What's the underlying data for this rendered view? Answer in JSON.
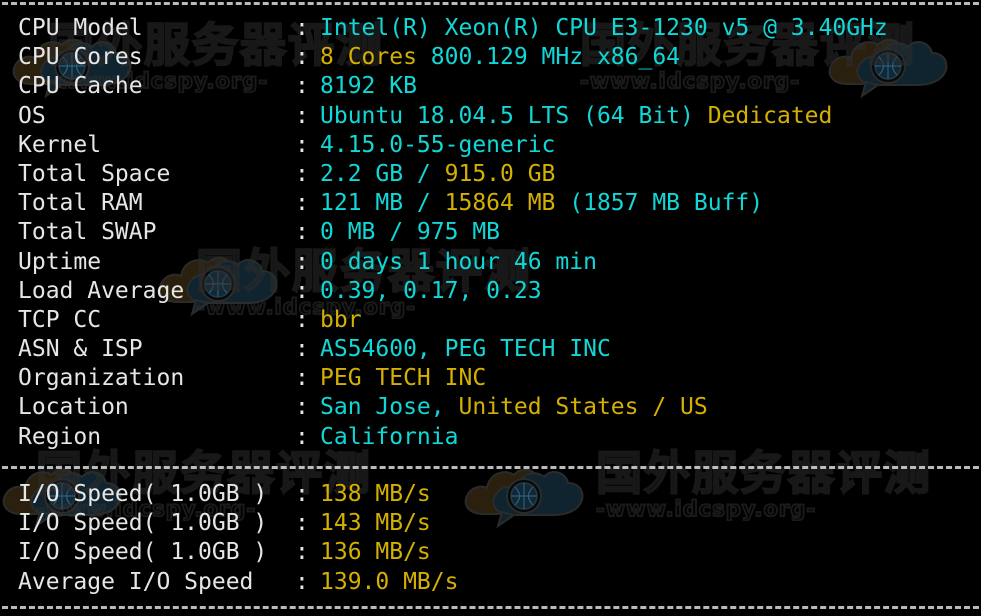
{
  "terminal": {
    "background_color": "#000000",
    "label_color": "#e6e6e6",
    "cyan_color": "#11d7d7",
    "yellow_color": "#d4b000",
    "separator_char": "-"
  },
  "watermark": {
    "cn_text": "国外服务器评测",
    "url_text": "-www.idcspy.org-",
    "logo_name": "cloud-globe-logo"
  },
  "system_info": {
    "section_name": "system-information",
    "rows": [
      {
        "label": "CPU Model",
        "separator": ":",
        "value": "Intel(R) Xeon(R) CPU E3-1230 v5 @ 3.40GHz",
        "segments": [
          {
            "text": "Intel(R) Xeon(R) CPU E3-1230 v5 @ 3.40GHz",
            "color": "cyan"
          }
        ]
      },
      {
        "label": "CPU Cores",
        "separator": ":",
        "value": "8 Cores 800.129 MHz x86_64",
        "segments": [
          {
            "text": "8 Cores",
            "color": "yellow"
          },
          {
            "text": " 800.129 MHz x86_64",
            "color": "cyan"
          }
        ]
      },
      {
        "label": "CPU Cache",
        "separator": ":",
        "value": "8192 KB",
        "segments": [
          {
            "text": "8192 KB",
            "color": "cyan"
          }
        ]
      },
      {
        "label": "OS",
        "separator": ":",
        "value": "Ubuntu 18.04.5 LTS (64 Bit) Dedicated",
        "segments": [
          {
            "text": "Ubuntu 18.04.5 LTS (64 Bit) ",
            "color": "cyan"
          },
          {
            "text": "Dedicated",
            "color": "yellow"
          }
        ]
      },
      {
        "label": "Kernel",
        "separator": ":",
        "value": "4.15.0-55-generic",
        "segments": [
          {
            "text": "4.15.0-55-generic",
            "color": "cyan"
          }
        ]
      },
      {
        "label": "Total Space",
        "separator": ":",
        "value": "2.2 GB / 915.0 GB",
        "segments": [
          {
            "text": "2.2 GB / ",
            "color": "cyan"
          },
          {
            "text": "915.0 GB",
            "color": "yellow"
          }
        ]
      },
      {
        "label": "Total RAM",
        "separator": ":",
        "value": "121 MB / 15864 MB (1857 MB Buff)",
        "segments": [
          {
            "text": "121 MB / ",
            "color": "cyan"
          },
          {
            "text": "15864 MB",
            "color": "yellow"
          },
          {
            "text": " (1857 MB Buff)",
            "color": "cyan"
          }
        ]
      },
      {
        "label": "Total SWAP",
        "separator": ":",
        "value": "0 MB / 975 MB",
        "segments": [
          {
            "text": "0 MB / 975 MB",
            "color": "cyan"
          }
        ]
      },
      {
        "label": "Uptime",
        "separator": ":",
        "value": "0 days 1 hour 46 min",
        "segments": [
          {
            "text": "0 days 1 hour 46 min",
            "color": "cyan"
          }
        ]
      },
      {
        "label": "Load Average",
        "separator": ":",
        "value": "0.39, 0.17, 0.23",
        "segments": [
          {
            "text": "0.39, 0.17, 0.23",
            "color": "cyan"
          }
        ]
      },
      {
        "label": "TCP CC",
        "separator": ":",
        "value": "bbr",
        "segments": [
          {
            "text": "bbr",
            "color": "yellow"
          }
        ]
      },
      {
        "label": "ASN & ISP",
        "separator": ":",
        "value": "AS54600, PEG TECH INC",
        "segments": [
          {
            "text": "AS54600, PEG TECH INC",
            "color": "cyan"
          }
        ]
      },
      {
        "label": "Organization",
        "separator": ":",
        "value": "PEG TECH INC",
        "segments": [
          {
            "text": "PEG TECH INC",
            "color": "yellow"
          }
        ]
      },
      {
        "label": "Location",
        "separator": ":",
        "value": "San Jose, United States / US",
        "segments": [
          {
            "text": "San Jose, ",
            "color": "cyan"
          },
          {
            "text": "United States / US",
            "color": "yellow"
          }
        ]
      },
      {
        "label": "Region",
        "separator": ":",
        "value": "California",
        "segments": [
          {
            "text": "California",
            "color": "cyan"
          }
        ]
      }
    ]
  },
  "io_test": {
    "section_name": "io-speed-test",
    "rows": [
      {
        "label": "I/O Speed( 1.0GB )",
        "separator": ":",
        "value": "138 MB/s",
        "segments": [
          {
            "text": "138 MB/s",
            "color": "yellow"
          }
        ]
      },
      {
        "label": "I/O Speed( 1.0GB )",
        "separator": ":",
        "value": "143 MB/s",
        "segments": [
          {
            "text": "143 MB/s",
            "color": "yellow"
          }
        ]
      },
      {
        "label": "I/O Speed( 1.0GB )",
        "separator": ":",
        "value": "136 MB/s",
        "segments": [
          {
            "text": "136 MB/s",
            "color": "yellow"
          }
        ]
      },
      {
        "label": "Average I/O Speed",
        "separator": ":",
        "value": "139.0 MB/s",
        "segments": [
          {
            "text": "139.0 MB/s",
            "color": "yellow"
          }
        ]
      }
    ]
  }
}
